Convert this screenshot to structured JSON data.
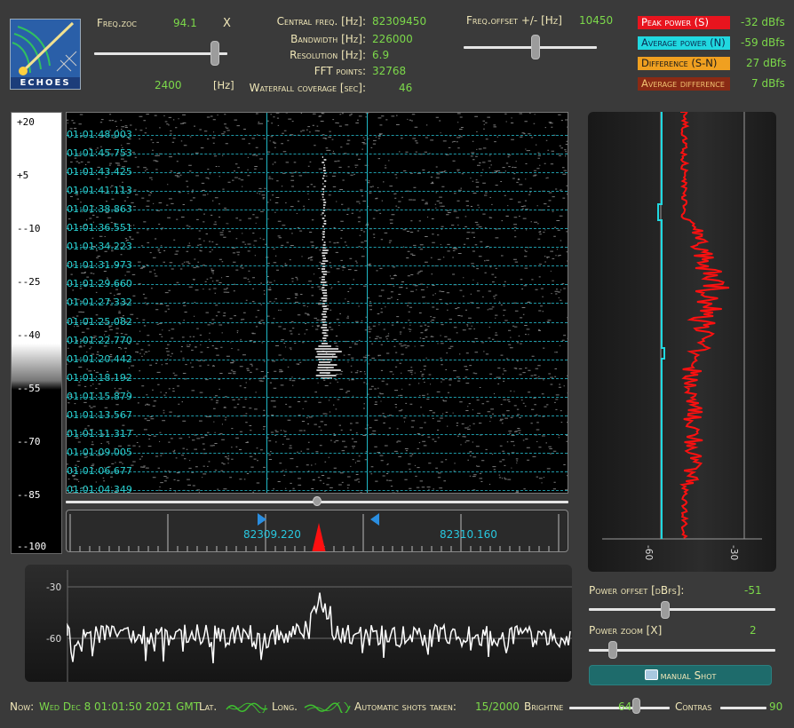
{
  "logo": {
    "text": "ECHOES"
  },
  "freq_zoom": {
    "label": "Freq.zoc",
    "value": "94.1",
    "unit": "X",
    "range_value": "2400",
    "range_unit": "[Hz]"
  },
  "info": {
    "central_freq_label": "Central freq. [Hz]:",
    "central_freq": "82309450",
    "bandwidth_label": "Bandwidth [Hz]:",
    "bandwidth": "226000",
    "resolution_label": "Resolution [Hz]:",
    "resolution": "6.9",
    "fft_label": "FFT points:",
    "fft": "32768",
    "waterfall_label": "Waterfall coverage [sec]:",
    "waterfall": "46"
  },
  "freq_offset": {
    "label": "Freq.offset +/- [Hz]",
    "value": "10450"
  },
  "badges": [
    {
      "label": "Peak power (S)",
      "value": "-32 dBfs",
      "bg": "#e8141e",
      "fg": "#ffffff"
    },
    {
      "label": "Average power (N)",
      "value": "-59 dBfs",
      "bg": "#20d8e0",
      "fg": "#0a2a50"
    },
    {
      "label": "Difference (S-N)",
      "value": "27 dBfs",
      "bg": "#f0a020",
      "fg": "#1a1a1a"
    },
    {
      "label": "Average difference",
      "value": "7 dBfs",
      "bg": "#8a2a14",
      "fg": "#f0c070"
    }
  ],
  "scale_labels": [
    "+20",
    "+5",
    "--10",
    "--25",
    "--40",
    "--55",
    "--70",
    "--85",
    "--100"
  ],
  "waterfall_times": [
    "01:01:48.003",
    "01:01:45.753",
    "01:01:43.425",
    "01:01:41.113",
    "01:01:38.863",
    "01:01:36.551",
    "01:01:34.223",
    "01:01:31.973",
    "01:01:29.660",
    "01:01:27.332",
    "01:01:25.082",
    "01:01:22.770",
    "01:01:20.442",
    "01:01:18.192",
    "01:01:15.879",
    "01:01:13.567",
    "01:01:11.317",
    "01:01:09.005",
    "01:01:06.677",
    "01:01:04.349"
  ],
  "freq_labels": [
    "82309.220",
    "82310.160"
  ],
  "spectrum_labels": [
    "-30",
    "-60"
  ],
  "power_panel_labels": [
    "-60",
    "-30"
  ],
  "power_offset": {
    "label": "Power offset [dBfs]:",
    "value": "-51"
  },
  "power_zoom": {
    "label": "Power zoom [X]",
    "value": "2"
  },
  "shot_button": {
    "label": "manual Shot"
  },
  "status": {
    "now_label": "Now:",
    "now": "Wed Dec 8 01:01:50 2021 GMT",
    "lat_label": "Lat.",
    "long_label": "Long.",
    "shots_label": "Automatic shots taken:",
    "shots": "15/2000",
    "brightness_label": "Brightne",
    "brightness": "64",
    "contrast_label": "Contras",
    "contrast": "90"
  }
}
